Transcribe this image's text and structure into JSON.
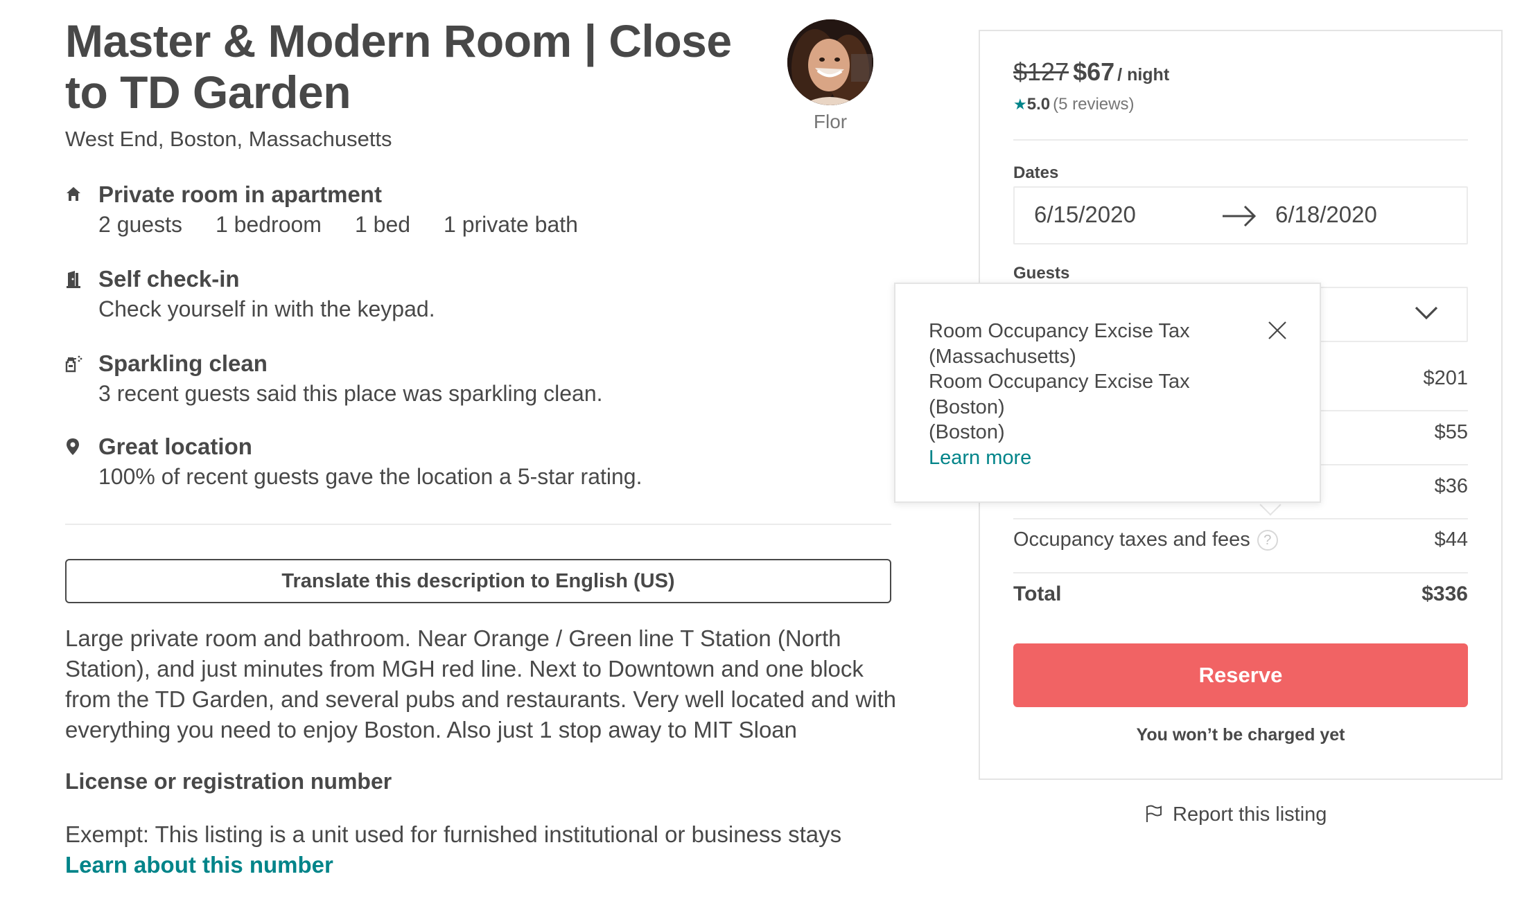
{
  "listing": {
    "title": "Master & Modern Room | Close to TD Garden",
    "location": "West End, Boston, Massachusetts"
  },
  "host": {
    "name": "Flor"
  },
  "features": {
    "room": {
      "icon": "home-icon",
      "title": "Private room in apartment",
      "details": [
        "2 guests",
        "1 bedroom",
        "1 bed",
        "1 private bath"
      ]
    },
    "checkin": {
      "icon": "door-icon",
      "title": "Self check-in",
      "desc": "Check yourself in with the keypad."
    },
    "clean": {
      "icon": "spray-bottle-icon",
      "title": "Sparkling clean",
      "desc": "3 recent guests said this place was sparkling clean."
    },
    "location": {
      "icon": "map-pin-icon",
      "title": "Great location",
      "desc": "100% of recent guests gave the location a 5-star rating."
    }
  },
  "translate_button": "Translate this description to English (US)",
  "description": "Large private room and bathroom. Near Orange / Green line T Station (North Station), and just minutes from MGH red line. Next to Downtown and one block from the TD Garden, and several pubs and restaurants. Very well located and with everything you need to enjoy Boston. Also just 1 stop away to MIT Sloan",
  "license": {
    "title": "License or registration number",
    "text": "Exempt: This listing is a unit used for furnished institutional or business stays",
    "link": "Learn about this number"
  },
  "booking": {
    "old_price": "$127",
    "price": "$67",
    "per": "/ night",
    "rating": "5.0",
    "reviews": "(5 reviews)",
    "dates_label": "Dates",
    "check_in": "6/15/2020",
    "check_out": "6/18/2020",
    "guests_label": "Guests",
    "fees": {
      "row1": "$201",
      "row2": "$55",
      "row3": "$36",
      "occupancy_label": "Occupancy taxes and fees",
      "occupancy_amount": "$44",
      "total_label": "Total",
      "total_amount": "$336"
    },
    "reserve": "Reserve",
    "note": "You won’t be charged yet"
  },
  "report": "Report this listing",
  "popover": {
    "line1": "Room Occupancy Excise Tax",
    "line2": "(Massachusetts)",
    "line3": "Room Occupancy Excise Tax",
    "line4": "(Boston)",
    "line5": "(Boston)",
    "link": "Learn more"
  },
  "colors": {
    "text": "#484848",
    "muted": "#767676",
    "teal": "#008489",
    "reserve": "#f16364",
    "border": "#ebebeb"
  }
}
